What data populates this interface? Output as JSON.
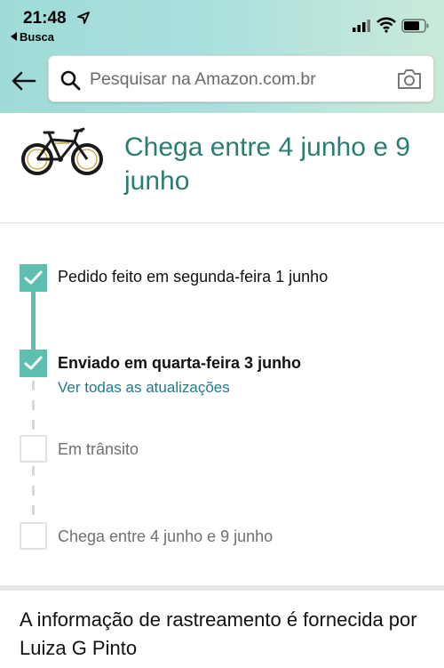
{
  "status_bar": {
    "time": "21:48",
    "back_app_label": "Busca"
  },
  "search": {
    "placeholder": "Pesquisar na Amazon.com.br"
  },
  "arrival": {
    "title": "Chega entre 4 junho e 9 junho"
  },
  "timeline": {
    "steps": [
      {
        "label": "Pedido feito em segunda-feira 1 junho",
        "status": "done"
      },
      {
        "label": "Enviado em quarta-feira 3 junho",
        "status": "done",
        "link": "Ver todas as atualizações"
      },
      {
        "label": "Em trânsito",
        "status": "pending"
      },
      {
        "label": "Chega entre 4 junho e 9 junho",
        "status": "pending"
      }
    ]
  },
  "carrier": {
    "text": "A informação de rastreamento é fornecida por Luiza G Pinto"
  },
  "colors": {
    "accent_teal": "#5ebfb0",
    "title_teal": "#2a7d72",
    "link_blue": "#1f7a8c"
  },
  "icons": [
    "location-arrow-icon",
    "signal-icon",
    "wifi-icon",
    "battery-icon",
    "back-arrow-icon",
    "search-icon",
    "camera-icon",
    "bicycle-image",
    "checkmark-icon"
  ]
}
